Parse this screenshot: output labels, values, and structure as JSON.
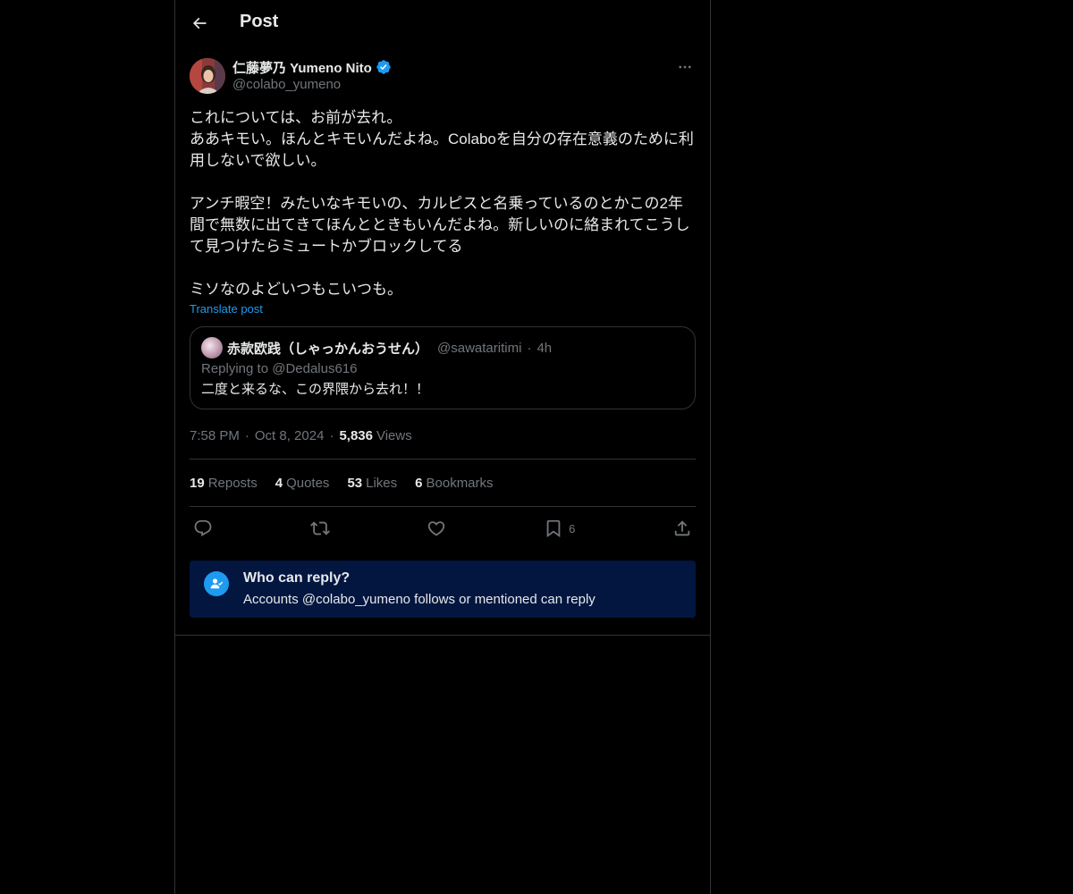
{
  "header": {
    "title": "Post"
  },
  "post": {
    "author": {
      "display_name": "仁藤夢乃 Yumeno Nito",
      "handle": "@colabo_yumeno",
      "verified": true
    },
    "text": "これについては、お前が去れ。\nああキモい。ほんとキモいんだよね。Colaboを自分の存在意義のために利用しないで欲しい。\n\nアンチ暇空！みたいなキモいの、カルピスと名乗っているのとかこの2年間で無数に出てきてほんとときもいんだよね。新しいのに絡まれてこうして見つけたらミュートかブロックしてる\n\nミソなのよどいつもこいつも。",
    "translate_label": "Translate post",
    "quote": {
      "author_name": "赤款欧践（しゃっかんおうせん）",
      "handle": "@sawataritimi",
      "separator": "·",
      "time": "4h",
      "replying_to": "Replying to @Dedalus616",
      "text": "二度と来るな、この界隈から去れ！！"
    },
    "meta": {
      "time": "7:58 PM",
      "separator": "·",
      "date": "Oct 8, 2024",
      "views_count": "5,836",
      "views_label": "Views"
    },
    "stats": {
      "reposts_count": "19",
      "reposts_label": "Reposts",
      "quotes_count": "4",
      "quotes_label": "Quotes",
      "likes_count": "53",
      "likes_label": "Likes",
      "bookmarks_count": "6",
      "bookmarks_label": "Bookmarks"
    },
    "actions": {
      "reply_icon": "reply-icon",
      "repost_icon": "repost-icon",
      "like_icon": "heart-icon",
      "bookmark_icon": "bookmark-icon",
      "bookmark_count": "6",
      "share_icon": "share-icon"
    },
    "who_can_reply": {
      "title": "Who can reply?",
      "description": "Accounts @colabo_yumeno follows or mentioned can reply"
    }
  },
  "colors": {
    "background": "#000000",
    "accent": "#1d9bf0",
    "muted": "#71767b",
    "text": "#e7e9ea",
    "border": "#2f3336",
    "who_reply_bg": "#031640"
  }
}
